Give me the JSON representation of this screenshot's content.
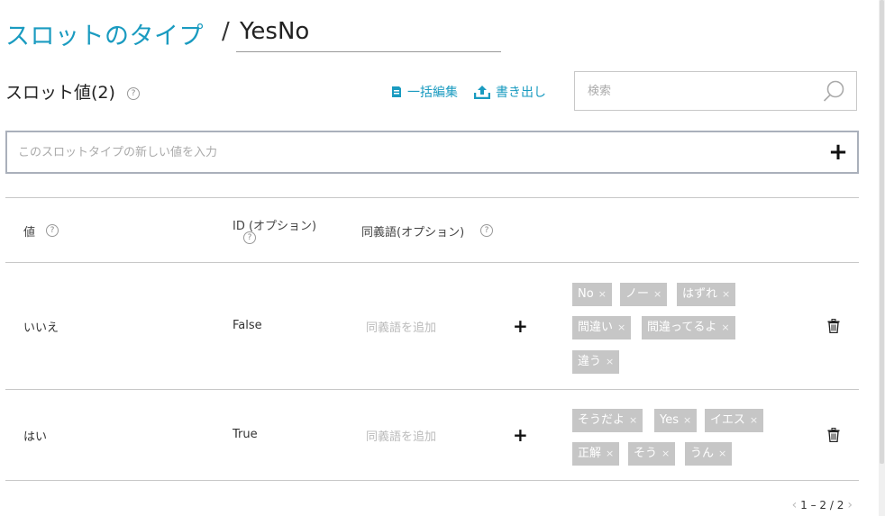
{
  "header": {
    "title_link": "スロットのタイプ",
    "separator": "/",
    "slot_type_name": "YesNo"
  },
  "section": {
    "title": "スロット値(2)",
    "help": "?"
  },
  "actions": {
    "bulk_edit": "一括編集",
    "export": "書き出し"
  },
  "search": {
    "placeholder": "検索"
  },
  "new_value": {
    "placeholder": "このスロットタイプの新しい値を入力",
    "add": "+"
  },
  "table": {
    "headers": {
      "value": "値",
      "id_line1": "ID (オプション)",
      "synonyms": "同義語(オプション)"
    },
    "help": "?",
    "add_synonym_placeholder": "同義語を追加",
    "add_synonym_button": "+",
    "rows": [
      {
        "value": "いいえ",
        "id": "False",
        "synonyms": [
          "No",
          "ノー",
          "はずれ",
          "間違い",
          "間違ってるよ",
          "違う"
        ]
      },
      {
        "value": "はい",
        "id": "True",
        "synonyms": [
          "そうだよ",
          "Yes",
          "イエス",
          "正解",
          "そう",
          "うん"
        ]
      }
    ],
    "tag_remove": "×"
  },
  "pager": {
    "prev": "‹",
    "label": "1 – 2 / 2",
    "next": "›"
  },
  "colors": {
    "accent": "#1a9bc0",
    "tag_bg": "#c6c6c6"
  }
}
